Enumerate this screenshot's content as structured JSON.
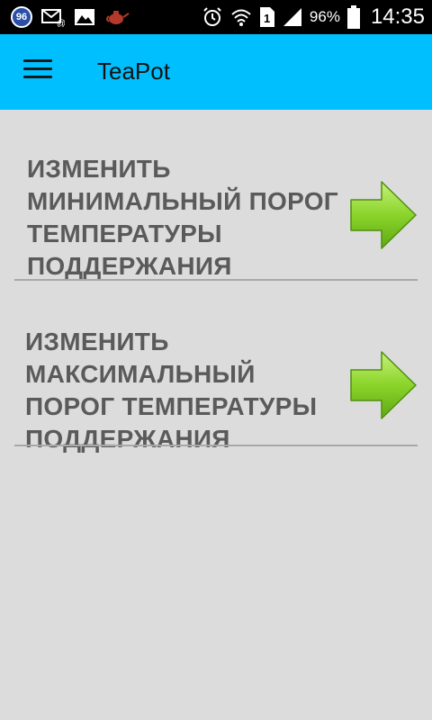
{
  "status_bar": {
    "badge": "96",
    "battery_percent": "96%",
    "time": "14:35",
    "sim": "1",
    "icons": [
      "notification-96-icon",
      "mail-icon",
      "image-icon",
      "teapot-icon",
      "alarm-icon",
      "wifi-icon",
      "sim-icon",
      "signal-icon",
      "battery-icon"
    ]
  },
  "app_bar": {
    "title": "TeaPot",
    "menu_icon": "hamburger-menu-icon",
    "color": "#00bfff"
  },
  "rows": [
    {
      "label": "ИЗМЕНИТЬ МИНИМАЛЬНЫЙ ПОРОГ ТЕМПЕРАТУРЫ ПОДДЕРЖАНИЯ",
      "icon": "green-arrow-right-icon"
    },
    {
      "label": "ИЗМЕНИТЬ МАКСИМАЛЬНЫЙ ПОРОГ ТЕМПЕРАТУРЫ ПОДДЕРЖАНИЯ",
      "icon": "green-arrow-right-icon"
    }
  ],
  "colors": {
    "background": "#dcdcdc",
    "text": "#5a5a5a",
    "arrow": "#7ed321"
  }
}
